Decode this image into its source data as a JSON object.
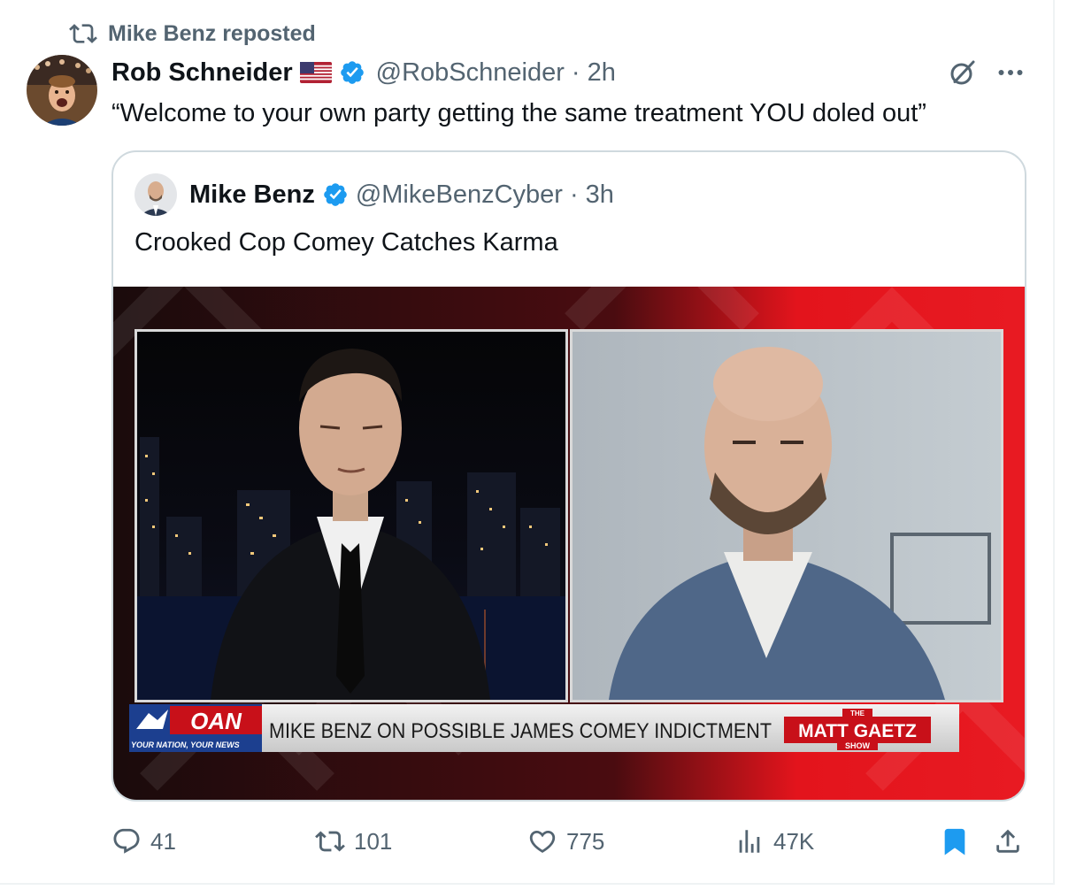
{
  "repost": {
    "label": "Mike Benz reposted",
    "icon": "repost-icon"
  },
  "tweet": {
    "name": "Rob Schneider",
    "flag": "us-flag-icon",
    "handle": "@RobSchneider",
    "separator": "·",
    "time": "2h",
    "text": "“Welcome to your own party getting the same treatment YOU doled out”"
  },
  "quote": {
    "name": "Mike Benz",
    "handle": "@MikeBenzCyber",
    "separator": "·",
    "time": "3h",
    "text": "Crooked Cop Comey Catches Karma",
    "media": {
      "network_logo": "OAN",
      "network_tagline": "YOUR NATION, YOUR NEWS",
      "chyron": "MIKE BENZ ON POSSIBLE JAMES COMEY INDICTMENT",
      "show_prefix": "THE",
      "show_name": "MATT GAETZ",
      "show_suffix": "SHOW"
    }
  },
  "actions": {
    "replies": "41",
    "reposts": "101",
    "likes": "775",
    "views": "47K"
  },
  "colors": {
    "verified": "#1d9bf0",
    "secondary_text": "#536471",
    "bookmark_active": "#1d9bf0",
    "border": "#cfd9de",
    "broadcast_red": "#e3141c"
  }
}
